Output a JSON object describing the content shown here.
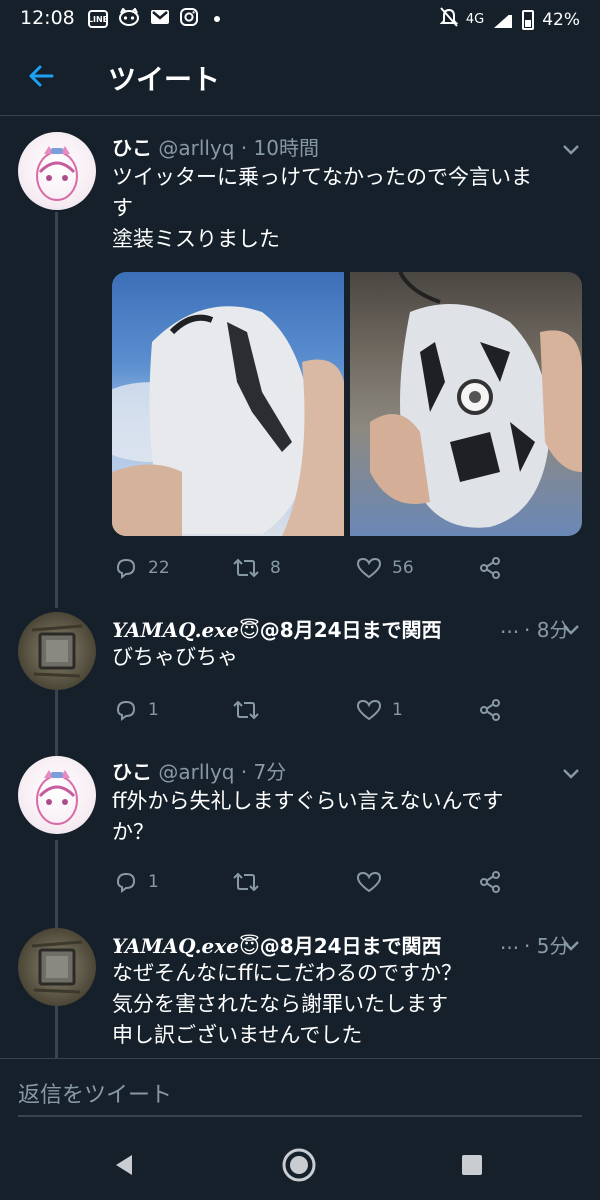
{
  "status_bar": {
    "time": "12:08",
    "network": "4G",
    "battery": "42%",
    "left_icons": [
      "line-icon",
      "raccoon-app-icon",
      "gmail-icon",
      "instagram-icon",
      "notification-dot-icon"
    ],
    "right_icons": [
      "mute-icon",
      "signal-icon",
      "battery-icon"
    ]
  },
  "header": {
    "title": "ツイート",
    "back_icon": "arrow-left-icon"
  },
  "colors": {
    "background": "#15202b",
    "border": "#38444d",
    "secondary_text": "#8899a6",
    "accent": "#1da1f2"
  },
  "tweets": [
    {
      "name": "ひこ",
      "handle": "@arllyq",
      "time": "· 10時間",
      "text_lines": [
        "ツイッターに乗っけてなかったので今言いま",
        "す",
        "塗装ミスりました"
      ],
      "has_media": true,
      "reply_count": "22",
      "retweet_count": "8",
      "like_count": "56"
    },
    {
      "name": "YAMAQ.exe",
      "name_emoji": "😇",
      "name_rest": "@8月24日まで関西",
      "ellipsis": "...",
      "time": "· 8分",
      "text_lines": [
        "びちゃびちゃ"
      ],
      "reply_count": "1",
      "retweet_count": "",
      "like_count": "1"
    },
    {
      "name": "ひこ",
      "handle": "@arllyq",
      "time": "· 7分",
      "text_lines": [
        "ff外から失礼しますぐらい言えないんです",
        "か？"
      ],
      "reply_count": "1",
      "retweet_count": "",
      "like_count": ""
    },
    {
      "name": "YAMAQ.exe",
      "name_emoji": "😇",
      "name_rest": "@8月24日まで関西",
      "ellipsis": "...",
      "time": "· 5分",
      "text_lines": [
        "なぜそんなにffにこだわるのですか？",
        "気分を害されたなら謝罪いたします",
        "申し訳ございませんでした"
      ]
    }
  ],
  "reply_bar": {
    "placeholder": "返信をツイート"
  },
  "nav": [
    "back-triangle-icon",
    "home-circle-icon",
    "recents-square-icon"
  ]
}
